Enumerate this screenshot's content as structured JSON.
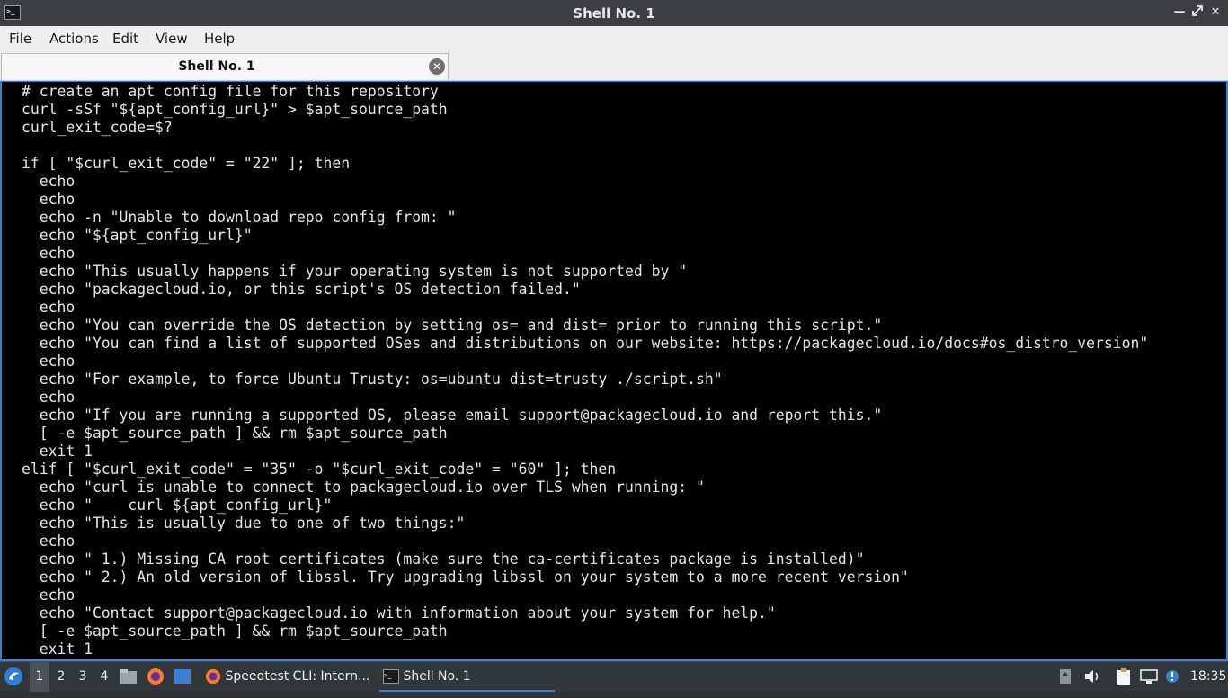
{
  "window": {
    "title": "Shell No. 1",
    "icon": "terminal-icon",
    "controls": [
      "minimize-icon",
      "maximize-icon",
      "close-icon"
    ]
  },
  "menu": {
    "file": "File",
    "actions": "Actions",
    "edit": "Edit",
    "view": "View",
    "help": "Help"
  },
  "tabs": [
    {
      "label": "Shell No. 1",
      "close_icon": "close-circle-icon"
    }
  ],
  "terminal": {
    "lines": [
      "# create an apt config file for this repository",
      "curl -sSf \"${apt_config_url}\" > $apt_source_path",
      "curl_exit_code=$?",
      "",
      "if [ \"$curl_exit_code\" = \"22\" ]; then",
      "  echo",
      "  echo",
      "  echo -n \"Unable to download repo config from: \"",
      "  echo \"${apt_config_url}\"",
      "  echo",
      "  echo \"This usually happens if your operating system is not supported by \"",
      "  echo \"packagecloud.io, or this script's OS detection failed.\"",
      "  echo",
      "  echo \"You can override the OS detection by setting os= and dist= prior to running this script.\"",
      "  echo \"You can find a list of supported OSes and distributions on our website: https://packagecloud.io/docs#os_distro_version\"",
      "  echo",
      "  echo \"For example, to force Ubuntu Trusty: os=ubuntu dist=trusty ./script.sh\"",
      "  echo",
      "  echo \"If you are running a supported OS, please email support@packagecloud.io and report this.\"",
      "  [ -e $apt_source_path ] && rm $apt_source_path",
      "  exit 1",
      "elif [ \"$curl_exit_code\" = \"35\" -o \"$curl_exit_code\" = \"60\" ]; then",
      "  echo \"curl is unable to connect to packagecloud.io over TLS when running: \"",
      "  echo \"    curl ${apt_config_url}\"",
      "  echo \"This is usually due to one of two things:\"",
      "  echo",
      "  echo \" 1.) Missing CA root certificates (make sure the ca-certificates package is installed)\"",
      "  echo \" 2.) An old version of libssl. Try upgrading libssl on your system to a more recent version\"",
      "  echo",
      "  echo \"Contact support@packagecloud.io with information about your system for help.\"",
      "  [ -e $apt_source_path ] && rm $apt_source_path",
      "  exit 1"
    ]
  },
  "taskbar": {
    "start_icon": "lxqt-start-icon",
    "workspaces": [
      "1",
      "2",
      "3",
      "4"
    ],
    "active_workspace": "1",
    "launchers": [
      "file-manager-icon",
      "firefox-icon",
      "show-desktop-icon"
    ],
    "tasks": [
      {
        "label": "Speedtest CLI: Intern...",
        "icon": "firefox-icon"
      },
      {
        "label": "Shell No. 1",
        "icon": "terminal-icon",
        "active": true
      }
    ],
    "tray_icons": [
      "removable-media-icon",
      "volume-icon",
      "clipboard-icon",
      "network-icon",
      "notification-icon"
    ],
    "clock": "18:35"
  },
  "colors": {
    "terminal_bg": "#000000",
    "terminal_fg": "#e6e6e6",
    "accent": "#3d7fd0",
    "titlebar_bg": "#3c3f41",
    "taskbar_bg": "#31363b"
  }
}
